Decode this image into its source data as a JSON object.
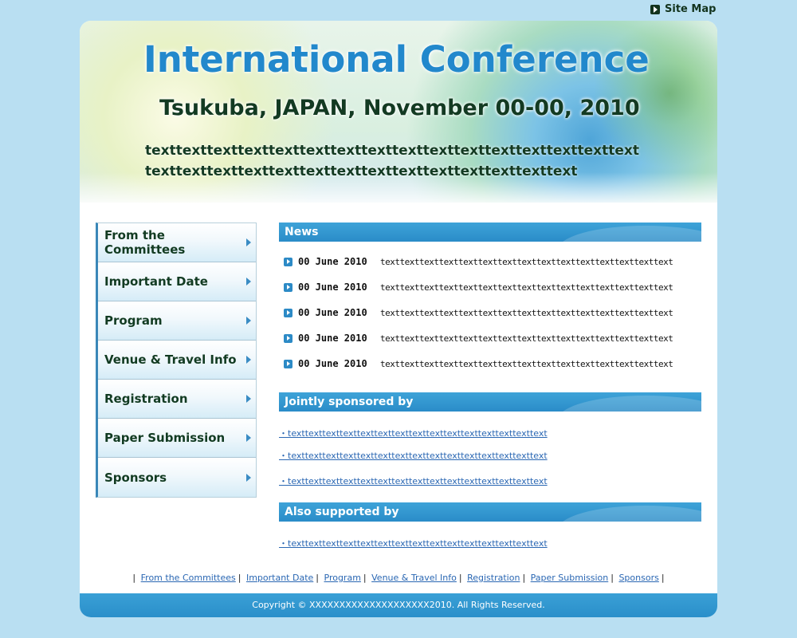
{
  "top": {
    "sitemap_label": "Site Map"
  },
  "banner": {
    "title": "International Conference",
    "subtitle": "Tsukuba, JAPAN, November 00-00, 2010",
    "description": "texttexttexttexttexttexttexttexttexttexttexttexttexttexttexttexttexttexttexttexttexttexttexttexttexttexttexttexttexttext"
  },
  "sidebar": {
    "items": [
      {
        "label": "From the Committees"
      },
      {
        "label": "Important Date"
      },
      {
        "label": "Program"
      },
      {
        "label": "Venue & Travel Info"
      },
      {
        "label": "Registration"
      },
      {
        "label": "Paper Submission"
      },
      {
        "label": "Sponsors"
      }
    ]
  },
  "news": {
    "heading": "News",
    "items": [
      {
        "date": "00 June 2010",
        "text": "texttexttexttexttexttexttexttexttexttexttexttexttexttexttext"
      },
      {
        "date": "00 June 2010",
        "text": "texttexttexttexttexttexttexttexttexttexttexttexttexttexttext"
      },
      {
        "date": "00 June 2010",
        "text": "texttexttexttexttexttexttexttexttexttexttexttexttexttexttext"
      },
      {
        "date": "00 June 2010",
        "text": "texttexttexttexttexttexttexttexttexttexttexttexttexttexttext"
      },
      {
        "date": "00 June 2010",
        "text": "texttexttexttexttexttexttexttexttexttexttexttexttexttexttext"
      }
    ]
  },
  "jointly": {
    "heading": "Jointly sponsored by",
    "links": [
      "・texttexttexttexttexttexttexttexttexttexttexttexttexttexttext",
      "・texttexttexttexttexttexttexttexttexttexttexttexttexttexttext",
      "・texttexttexttexttexttexttexttexttexttexttexttexttexttexttext"
    ]
  },
  "also": {
    "heading": "Also supported by",
    "links": [
      "・texttexttexttexttexttexttexttexttexttexttexttexttexttexttext"
    ]
  },
  "footer_links": [
    "From the Committees",
    "Important Date",
    "Program",
    "Venue & Travel Info",
    "Registration",
    "Paper Submission",
    "Sponsors"
  ],
  "footer_sep": "|",
  "copyright": "Copyright © XXXXXXXXXXXXXXXXXXXX2010. All Rights Reserved.",
  "colors": {
    "background": "#b9dff2",
    "accent": "#2a8cc8",
    "nav_text": "#123b22",
    "link": "#2a67b3"
  }
}
